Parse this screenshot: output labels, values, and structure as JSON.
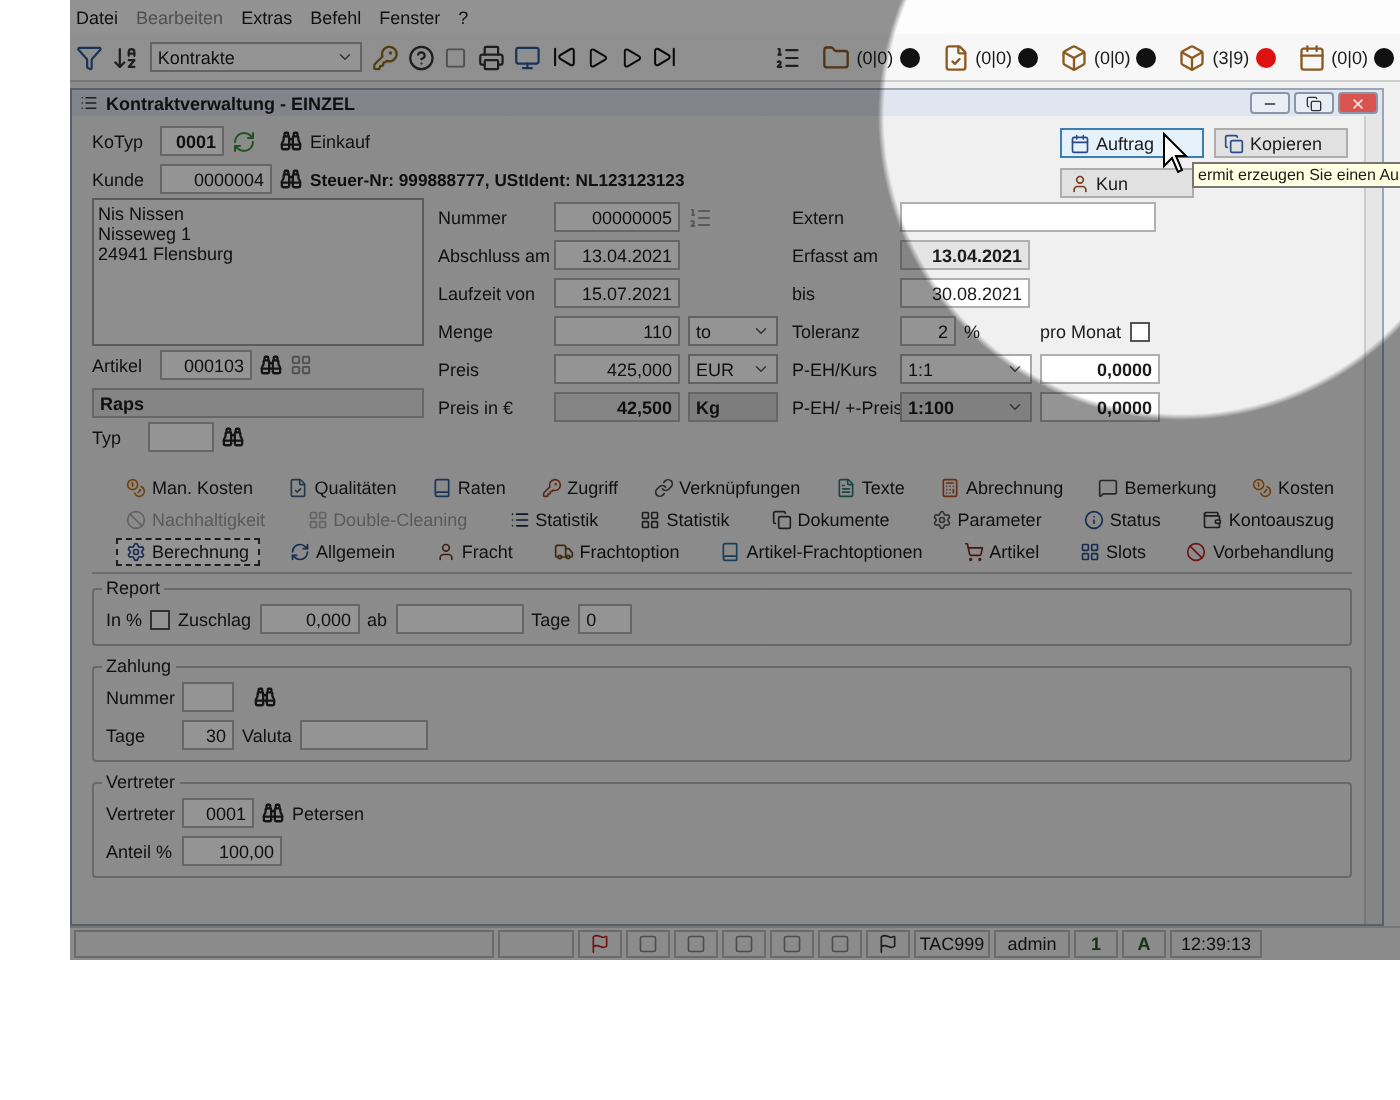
{
  "menu": [
    {
      "label": "Datei",
      "disabled": false
    },
    {
      "label": "Bearbeiten",
      "disabled": true
    },
    {
      "label": "Extras",
      "disabled": false
    },
    {
      "label": "Befehl",
      "disabled": false
    },
    {
      "label": "Fenster",
      "disabled": false
    },
    {
      "label": "?",
      "disabled": false
    }
  ],
  "toolbar": {
    "module": "Kontrakte",
    "counters": [
      {
        "text": "(0|0)",
        "color": "#111111"
      },
      {
        "text": "(0|0)",
        "color": "#111111"
      },
      {
        "text": "(0|0)",
        "color": "#111111"
      },
      {
        "text": "(3|9)",
        "color": "#e01010"
      },
      {
        "text": "(0|0)",
        "color": "#111111"
      }
    ]
  },
  "window": {
    "title": "Kontraktverwaltung - EINZEL"
  },
  "header": {
    "kotyp_label": "KoTyp",
    "kotyp": "0001",
    "kotyp_name": "Einkauf",
    "kunde_label": "Kunde",
    "kunde": "0000004",
    "tax": "Steuer-Nr: 999888777, UStIdent: NL123123123",
    "address": [
      "Nis Nissen",
      "Nisseweg 1",
      "24941 Flensburg"
    ],
    "artikel_label": "Artikel",
    "artikel": "000103",
    "artikel_name": "Raps",
    "typ_label": "Typ"
  },
  "actions": [
    {
      "label": "Auftrag",
      "focused": true
    },
    {
      "label": "Kopieren",
      "focused": false
    },
    {
      "label": "Kun",
      "focused": false
    }
  ],
  "tooltip": "ermit erzeugen Sie einen Au",
  "middle": [
    {
      "label": "Nummer",
      "value": "00000005",
      "kind": "number"
    },
    {
      "label": "Abschluss am",
      "value": "13.04.2021",
      "kind": "plain"
    },
    {
      "label": "Laufzeit von",
      "value": "15.07.2021",
      "kind": "plain"
    },
    {
      "label": "Menge",
      "value": "110",
      "kind": "combo",
      "unit": "to"
    },
    {
      "label": "Preis",
      "value": "425,000",
      "kind": "combo",
      "unit": "EUR"
    },
    {
      "label": "Preis in €",
      "value": "42,500",
      "kind": "static",
      "unit": "Kg"
    }
  ],
  "right": [
    {
      "label": "Extern",
      "kind": "wide"
    },
    {
      "label": "Erfasst am",
      "value": "13.04.2021",
      "kind": "readonly"
    },
    {
      "label": "bis",
      "value": "30.08.2021",
      "kind": "plain"
    },
    {
      "label": "Toleranz",
      "value": "2",
      "kind": "tolerance",
      "suffix": "%",
      "check_label": "pro Monat",
      "checked": false
    },
    {
      "label": "P-EH/Kurs",
      "kind": "combo",
      "option": "1:1",
      "value": "0,0000",
      "disabled": false
    },
    {
      "label": "P-EH/ +-Preis",
      "kind": "combo",
      "option": "1:100",
      "value": "0,0000",
      "disabled": true
    }
  ],
  "tabs": [
    [
      {
        "label": "Man. Kosten",
        "selected": false,
        "disabled": false
      },
      {
        "label": "Qualitäten",
        "selected": false,
        "disabled": false
      },
      {
        "label": "Raten",
        "selected": false,
        "disabled": false
      },
      {
        "label": "Zugriff",
        "selected": false,
        "disabled": false
      },
      {
        "label": "Verknüpfungen",
        "selected": false,
        "disabled": false
      },
      {
        "label": "Texte",
        "selected": false,
        "disabled": false
      },
      {
        "label": "Abrechnung",
        "selected": false,
        "disabled": false
      },
      {
        "label": "Bemerkung",
        "selected": false,
        "disabled": false
      },
      {
        "label": "Kosten",
        "selected": false,
        "disabled": false
      }
    ],
    [
      {
        "label": "Nachhaltigkeit",
        "selected": false,
        "disabled": true
      },
      {
        "label": "Double-Cleaning",
        "selected": false,
        "disabled": true
      },
      {
        "label": "Statistik",
        "selected": false,
        "disabled": false
      },
      {
        "label": "Statistik",
        "selected": false,
        "disabled": false
      },
      {
        "label": "Dokumente",
        "selected": false,
        "disabled": false
      },
      {
        "label": "Parameter",
        "selected": false,
        "disabled": false
      },
      {
        "label": "Status",
        "selected": false,
        "disabled": false
      },
      {
        "label": "Kontoauszug",
        "selected": false,
        "disabled": false
      }
    ],
    [
      {
        "label": "Berechnung",
        "selected": true,
        "disabled": false
      },
      {
        "label": "Allgemein",
        "selected": false,
        "disabled": false
      },
      {
        "label": "Fracht",
        "selected": false,
        "disabled": false
      },
      {
        "label": "Frachtoption",
        "selected": false,
        "disabled": false
      },
      {
        "label": "Artikel-Frachtoptionen",
        "selected": false,
        "disabled": false
      },
      {
        "label": "Artikel",
        "selected": false,
        "disabled": false
      },
      {
        "label": "Slots",
        "selected": false,
        "disabled": false
      },
      {
        "label": "Vorbehandlung",
        "selected": false,
        "disabled": false
      }
    ]
  ],
  "report": {
    "title": "Report",
    "in_pct_label": "In %",
    "in_pct": false,
    "zuschlag_label": "Zuschlag",
    "zuschlag": "0,000",
    "ab_label": "ab",
    "tage_label": "Tage",
    "tage": "0"
  },
  "zahlung": {
    "title": "Zahlung",
    "nummer_label": "Nummer",
    "tage_label": "Tage",
    "tage": "30",
    "valuta_label": "Valuta"
  },
  "vertreter": {
    "title": "Vertreter",
    "vertreter_label": "Vertreter",
    "vertreter": "0001",
    "vertreter_name": "Petersen",
    "anteil_label": "Anteil %",
    "anteil": "100,00"
  },
  "status_bar": [
    {
      "kind": "empty"
    },
    {
      "kind": "empty"
    },
    {
      "kind": "icon"
    },
    {
      "kind": "icon"
    },
    {
      "kind": "icon"
    },
    {
      "kind": "icon"
    },
    {
      "kind": "icon"
    },
    {
      "kind": "icon"
    },
    {
      "kind": "icon"
    },
    {
      "kind": "text",
      "text": "TAC999"
    },
    {
      "kind": "text",
      "text": "admin"
    },
    {
      "kind": "glyph",
      "text": "1"
    },
    {
      "kind": "glyph",
      "text": "A"
    },
    {
      "kind": "text",
      "text": "12:39:13"
    }
  ]
}
